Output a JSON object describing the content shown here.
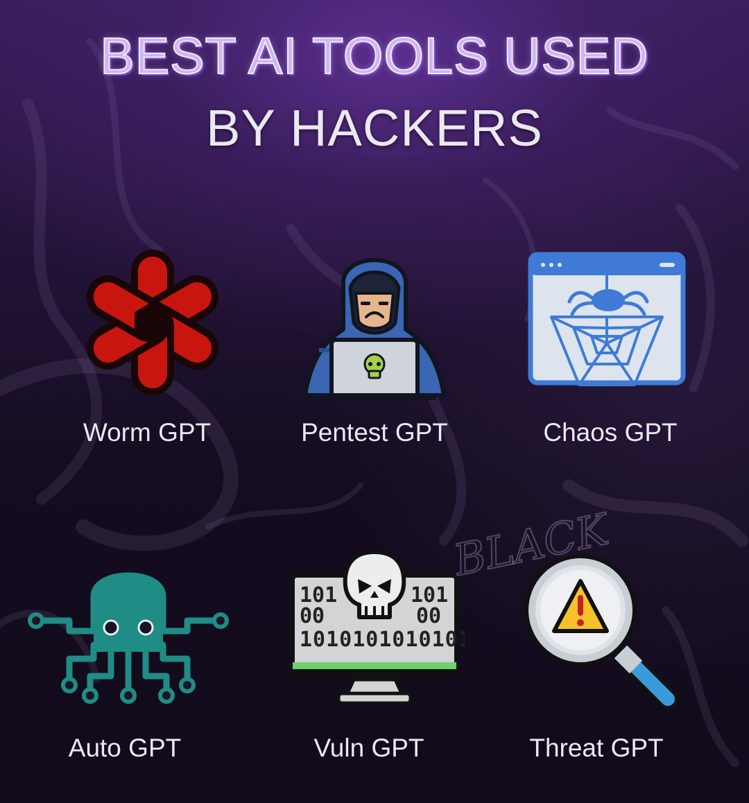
{
  "title": {
    "line1": "BEST AI TOOLS USED",
    "line2": "BY HACKERS"
  },
  "background_text": "BLACK",
  "colors": {
    "title_line1": "#cdb6f2",
    "title_line2": "#ece8f2",
    "label": "#ece8f4",
    "worm_red": "#c9150f",
    "hood_blue": "#3a66b3",
    "chaos_blue": "#3f7bd6",
    "auto_teal": "#1f8c86",
    "warning_yellow": "#f6c12b"
  },
  "tools": [
    {
      "label": "Worm GPT",
      "icon": "openai-knot-icon"
    },
    {
      "label": "Pentest GPT",
      "icon": "hooded-hacker-laptop-icon"
    },
    {
      "label": "Chaos GPT",
      "icon": "spider-web-browser-icon"
    },
    {
      "label": "Auto GPT",
      "icon": "circuit-octopus-icon"
    },
    {
      "label": "Vuln GPT",
      "icon": "skull-binary-monitor-icon"
    },
    {
      "label": "Threat GPT",
      "icon": "warning-magnifier-icon"
    }
  ]
}
